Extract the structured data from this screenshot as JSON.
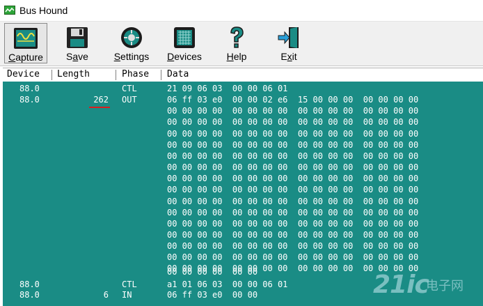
{
  "window": {
    "title": "Bus Hound"
  },
  "toolbar": [
    {
      "label": "Capture",
      "key": "C",
      "rest": "apture",
      "icon": "capture-icon"
    },
    {
      "label": "Save",
      "key": "S",
      "rest": "ave",
      "icon": "floppy-disk-icon"
    },
    {
      "label": "Settings",
      "key": "S",
      "rest": "ettings",
      "icon": "settings-dial-icon"
    },
    {
      "label": "Devices",
      "key": "D",
      "rest": "evices",
      "icon": "chip-icon"
    },
    {
      "label": "Help",
      "key": "H",
      "rest": "elp",
      "icon": "question-icon"
    },
    {
      "label": "Exit",
      "key": "E",
      "rest": "xit",
      "icon": "exit-door-icon"
    }
  ],
  "columns": [
    "Device",
    "Length",
    "Phase",
    "Data"
  ],
  "rows": [
    {
      "device": "88.0",
      "length": "",
      "phase": "CTL",
      "data": "21 09 06 03  00 00 06 01"
    },
    {
      "device": "88.0",
      "length": "262",
      "phase": "OUT",
      "data": "06 ff 03 e0  00 00 02 e6  15 00 00 00  00 00 00 00"
    },
    {
      "device": "",
      "length": "",
      "phase": "",
      "data": "00 00 00 00  00 00 00 00  00 00 00 00  00 00 00 00"
    },
    {
      "device": "",
      "length": "",
      "phase": "",
      "data": "00 00 00 00  00 00 00 00  00 00 00 00  00 00 00 00"
    },
    {
      "device": "",
      "length": "",
      "phase": "",
      "data": "00 00 00 00  00 00 00 00  00 00 00 00  00 00 00 00"
    },
    {
      "device": "",
      "length": "",
      "phase": "",
      "data": "00 00 00 00  00 00 00 00  00 00 00 00  00 00 00 00"
    },
    {
      "device": "",
      "length": "",
      "phase": "",
      "data": "00 00 00 00  00 00 00 00  00 00 00 00  00 00 00 00"
    },
    {
      "device": "",
      "length": "",
      "phase": "",
      "data": "00 00 00 00  00 00 00 00  00 00 00 00  00 00 00 00"
    },
    {
      "device": "",
      "length": "",
      "phase": "",
      "data": "00 00 00 00  00 00 00 00  00 00 00 00  00 00 00 00"
    },
    {
      "device": "",
      "length": "",
      "phase": "",
      "data": "00 00 00 00  00 00 00 00  00 00 00 00  00 00 00 00"
    },
    {
      "device": "",
      "length": "",
      "phase": "",
      "data": "00 00 00 00  00 00 00 00  00 00 00 00  00 00 00 00"
    },
    {
      "device": "",
      "length": "",
      "phase": "",
      "data": "00 00 00 00  00 00 00 00  00 00 00 00  00 00 00 00"
    },
    {
      "device": "",
      "length": "",
      "phase": "",
      "data": "00 00 00 00  00 00 00 00  00 00 00 00  00 00 00 00"
    },
    {
      "device": "",
      "length": "",
      "phase": "",
      "data": "00 00 00 00  00 00 00 00  00 00 00 00  00 00 00 00"
    },
    {
      "device": "",
      "length": "",
      "phase": "",
      "data": "00 00 00 00  00 00 00 00  00 00 00 00  00 00 00 00"
    },
    {
      "device": "",
      "length": "",
      "phase": "",
      "data": "00 00 00 00  00 00 00 00  00 00 00 00  00 00 00 00"
    },
    {
      "device": "",
      "length": "",
      "phase": "",
      "data": "00 00 00 00  00 00 00 00  00 00 00 00  00 00 00 00"
    },
    {
      "device": "",
      "length": "",
      "phase": "",
      "data": "00 00 00 00  00 00"
    },
    {
      "device": "88.0",
      "length": "",
      "phase": "CTL",
      "data": "a1 01 06 03  00 00 06 01"
    },
    {
      "device": "88.0",
      "length": "6",
      "phase": "IN",
      "data": "06 ff 03 e0  00 00"
    }
  ],
  "watermark": {
    "main": "21ic",
    "sub": "电子网"
  },
  "colors": {
    "grid_bg": "#1a8c85",
    "grid_text": "#ffffff",
    "highlight": "#d81e1e"
  }
}
